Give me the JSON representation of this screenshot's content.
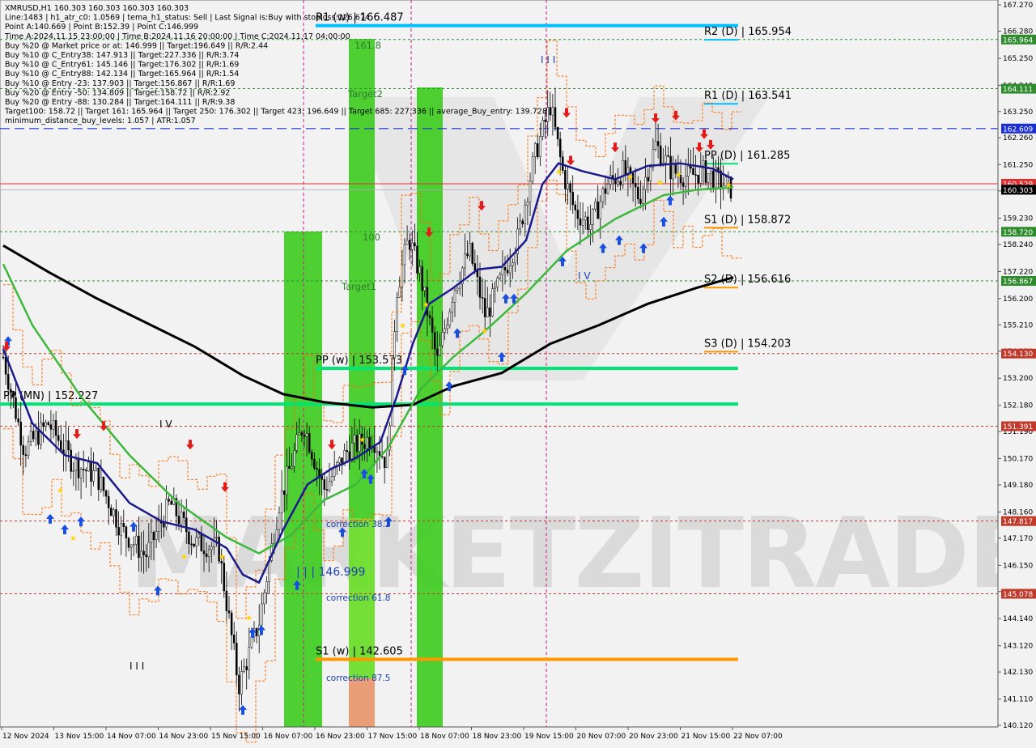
{
  "window": {
    "symbol": "XMRUSD,H1"
  },
  "info_lines": [
    "XMRUSD,H1  160.303 160.303 160.303 160.303",
    "Line:1483 | h1_atr_c0: 1.0569 | tema_h1_status: Sell | Last Signal is:Buy with stoploss:126.674",
    "Point A:140.669 | Point B:152.39 | Point C:146.999",
    "Time A:2024.11.15 23:00:00 | Time B:2024.11.16 20:00:00 | Time C:2024.11.17 04:00:00",
    "Buy %20 @ Market price or at: 146.999 || Target:196.649 || R/R:2.44",
    "Buy %10 @ C_Entry38: 147.913 || Target:227.336 || R/R:3.74",
    "Buy %10 @ C_Entry61: 145.146 || Target:176.302 || R/R:1.69",
    "Buy %10 @ C_Entry88: 142.134 || Target:165.964 || R/R:1.54",
    "Buy %10 @ Entry -23: 137.903 || Target:156.867 || R/R:1.69",
    "Buy %20 @ Entry -50: 134.809 || Target:158.72 || R/R:2.92",
    "Buy %20 @ Entry -88: 130.284 || Target:164.111 || R/R:9.38",
    "Target100: 158.72 || Target 161: 165.964 || Target 250: 176.302 || Target 423: 196.649 || Target 685: 227.336 || average_Buy_entry: 139.728",
    "minimum_distance_buy_levels: 1.057 | ATR:1.057"
  ],
  "chart_data": {
    "type": "candlestick",
    "symbol": "XMRUSD",
    "timeframe": "H1",
    "last_price": 160.303,
    "ylim": [
      140.12,
      167.27
    ],
    "y_ticks": [
      167.27,
      166.28,
      165.25,
      164.24,
      163.25,
      162.26,
      161.25,
      160.26,
      159.23,
      158.24,
      157.22,
      156.2,
      155.21,
      154.22,
      153.2,
      152.18,
      151.19,
      150.17,
      149.18,
      148.16,
      147.17,
      146.15,
      145.16,
      144.14,
      143.12,
      142.13,
      141.11,
      140.12
    ],
    "y_tick_labels": [
      "167.270",
      "166.280",
      "165.250",
      "164.240",
      "163.250",
      "162.260",
      "161.250",
      "160.260",
      "159.230",
      "158.240",
      "157.220",
      "156.200",
      "155.210",
      "154.220",
      "153.200",
      "152.180",
      "151.190",
      "150.170",
      "149.180",
      "148.160",
      "147.170",
      "146.150",
      "145.160",
      "144.140",
      "143.120",
      "142.130",
      "141.110",
      "140.120"
    ],
    "x_labels": [
      "12 Nov 2024",
      "13 Nov 15:00",
      "14 Nov 07:00",
      "14 Nov 23:00",
      "15 Nov 15:00",
      "16 Nov 07:00",
      "16 Nov 23:00",
      "17 Nov 15:00",
      "18 Nov 07:00",
      "18 Nov 23:00",
      "19 Nov 15:00",
      "20 Nov 07:00",
      "20 Nov 23:00",
      "21 Nov 15:00",
      "22 Nov 07:00"
    ],
    "price_badges": [
      {
        "value": 165.964,
        "label": "165.964",
        "color": "#2e8b2e"
      },
      {
        "value": 164.111,
        "label": "164.111",
        "color": "#2e8b2e"
      },
      {
        "value": 162.609,
        "label": "162.609",
        "color": "#1c2fd1"
      },
      {
        "value": 160.529,
        "label": "160.529",
        "color": "#e03030"
      },
      {
        "value": 160.303,
        "label": "160.303",
        "color": "#000000"
      },
      {
        "value": 158.72,
        "label": "158.720",
        "color": "#2e8b2e"
      },
      {
        "value": 156.867,
        "label": "156.867",
        "color": "#2e8b2e"
      },
      {
        "value": 154.13,
        "label": "154.130",
        "color": "#c0392b"
      },
      {
        "value": 151.391,
        "label": "151.391",
        "color": "#c0392b"
      },
      {
        "value": 147.817,
        "label": "147.817",
        "color": "#c0392b"
      },
      {
        "value": 145.078,
        "label": "145.078",
        "color": "#c0392b"
      }
    ],
    "pivot_levels": [
      {
        "label": "R1 (w) | 166.487",
        "value": 166.487,
        "color": "#00bfff",
        "scope": "weekly"
      },
      {
        "label": "R2 (D) | 165.954",
        "value": 165.954,
        "color": "#00bfff",
        "scope": "daily"
      },
      {
        "label": "R1 (D) | 163.541",
        "value": 163.541,
        "color": "#00bfff",
        "scope": "daily"
      },
      {
        "label": "PP (D) | 161.285",
        "value": 161.285,
        "color": "#00e676",
        "scope": "daily"
      },
      {
        "label": "S1 (D) | 158.872",
        "value": 158.872,
        "color": "#ff9800",
        "scope": "daily"
      },
      {
        "label": "S2 (D) | 156.616",
        "value": 156.616,
        "color": "#ff9800",
        "scope": "daily"
      },
      {
        "label": "S3 (D) | 154.203",
        "value": 154.203,
        "color": "#ff9800",
        "scope": "daily"
      },
      {
        "label": "PP (w) | 153.573",
        "value": 153.573,
        "color": "#00e676",
        "scope": "weekly"
      },
      {
        "label": "PP (MN) | 152.227",
        "value": 152.227,
        "color": "#00e676",
        "scope": "monthly"
      },
      {
        "label": "S1 (w) | 142.605",
        "value": 142.605,
        "color": "#ff9800",
        "scope": "weekly"
      }
    ],
    "zone_labels": [
      "161.8",
      "Target2",
      "100",
      "Target1"
    ],
    "correction_labels": [
      "correction 38.2",
      "correction 61.8",
      "correction 87.5"
    ],
    "point_c_label": "| | | 146.999",
    "wave_labels": [
      "I I I",
      "I V",
      "I I I",
      "I V"
    ],
    "watermark": "MARKETZITRADE",
    "series": [
      {
        "name": "ema_200",
        "color": "#000000"
      },
      {
        "name": "ema_50",
        "color": "#3cb83c"
      },
      {
        "name": "tema",
        "color": "#1a1a8c"
      }
    ]
  }
}
